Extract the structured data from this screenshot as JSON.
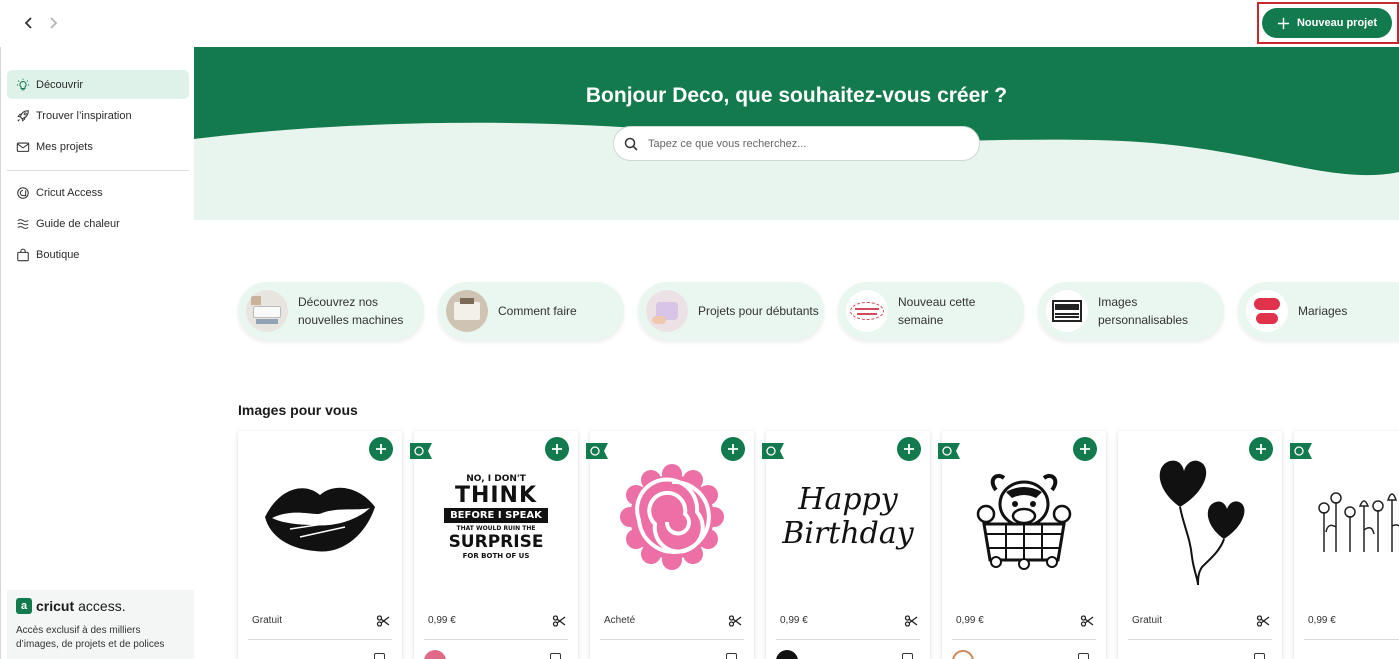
{
  "topbar": {
    "new_project_label": "Nouveau projet"
  },
  "sidebar": {
    "items": [
      {
        "label": "Découvrir",
        "icon": "lightbulb-icon",
        "active": true
      },
      {
        "label": "Trouver l’inspiration",
        "icon": "rocket-icon"
      },
      {
        "label": "Mes projets",
        "icon": "envelope-icon"
      },
      {
        "label": "Cricut Access",
        "icon": "cricut-access-icon"
      },
      {
        "label": "Guide de chaleur",
        "icon": "heat-waves-icon"
      },
      {
        "label": "Boutique",
        "icon": "shopping-bag-icon"
      }
    ],
    "access": {
      "brand_bold": "cricut",
      "brand_light": "access.",
      "text": "Accès exclusif à des milliers d’images, de projets et de polices"
    }
  },
  "hero": {
    "title": "Bonjour Deco, que souhaitez-vous créer ?",
    "search_placeholder": "Tapez ce que vous recherchez..."
  },
  "categories": [
    {
      "label": "Découvrez nos nouvelles machines"
    },
    {
      "label": "Comment faire"
    },
    {
      "label": "Projets pour débutants"
    },
    {
      "label": "Nouveau cette semaine"
    },
    {
      "label": "Images personnalisables"
    },
    {
      "label": "Mariages"
    }
  ],
  "images_section": {
    "title": "Images pour vous",
    "cards": [
      {
        "price": "Gratuit",
        "access": false,
        "art": "lips"
      },
      {
        "price": "0,99 €",
        "access": true,
        "art": "no-i-dont-think"
      },
      {
        "price": "Acheté",
        "access": true,
        "art": "rolled-flower"
      },
      {
        "price": "0,99 €",
        "access": true,
        "art": "happy-birthday"
      },
      {
        "price": "0,99 €",
        "access": true,
        "art": "highland-cow"
      },
      {
        "price": "Gratuit",
        "access": false,
        "art": "heart-balloons"
      },
      {
        "price": "0,99 €",
        "access": true,
        "art": "wildflowers"
      }
    ],
    "art_text": {
      "quote_line1": "NO, I DON'T",
      "quote_line2": "THINK",
      "quote_line3": "BEFORE I SPEAK",
      "quote_line4": "THAT WOULD RUIN THE",
      "quote_line5": "SURPRISE",
      "quote_line6": "FOR BOTH OF US",
      "birthday_line1": "Happy",
      "birthday_line2": "Birthday"
    }
  },
  "colors": {
    "brand_green": "#137a4d",
    "mint": "#eaf6f0",
    "highlight_red": "#c8282d"
  }
}
